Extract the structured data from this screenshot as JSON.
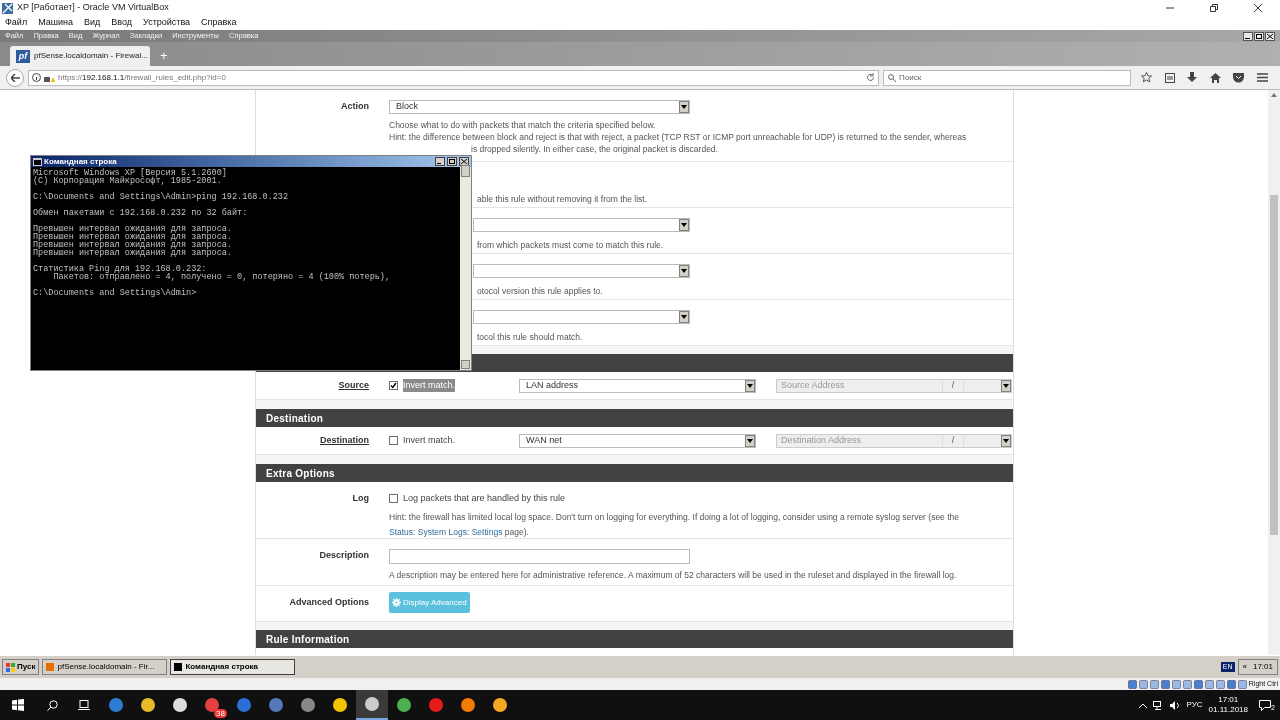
{
  "vbox": {
    "title": "XP [Работает] - Oracle VM VirtualBox",
    "menu": [
      "Файл",
      "Машина",
      "Вид",
      "Ввод",
      "Устройства",
      "Справка"
    ]
  },
  "firefox": {
    "menu": [
      "Файл",
      "Правка",
      "Вид",
      "Журнал",
      "Закладки",
      "Инструменты",
      "Справка"
    ],
    "tab": {
      "title": "pfSense.localdomain - Firewal...",
      "favicon": "pf"
    },
    "new_tab": "+",
    "url_prefix": "https://",
    "url_host": "192.168.1.1",
    "url_path": "/firewall_rules_edit.php?id=0",
    "search_placeholder": "Поиск"
  },
  "form": {
    "action": {
      "label": "Action",
      "value": "Block",
      "help": "Choose what to do with packets that match the criteria specified below.",
      "hint": "Hint: the difference between block and reject is that with reject, a packet (TCP RST or ICMP port unreachable for UDP) is returned to the sender, whereas",
      "hint_tail": "is dropped silently. In either case, the original packet is discarded."
    },
    "partial_rows": [
      {
        "kind": "text",
        "help": "able this rule without removing it from the list."
      },
      {
        "kind": "select",
        "help": "from which packets must come to match this rule."
      },
      {
        "kind": "select",
        "help": "otocol version this rule applies to."
      },
      {
        "kind": "select",
        "help": "tocol this rule should match."
      }
    ],
    "source": {
      "label": "Source",
      "invert_label": "Invert match.",
      "invert": true,
      "type": "LAN address",
      "address_placeholder": "Source Address",
      "slash": "/"
    },
    "destination_section": "Destination",
    "destination": {
      "label": "Destination",
      "invert_label": "Invert match.",
      "invert": false,
      "type": "WAN net",
      "address_placeholder": "Destination Address",
      "slash": "/"
    },
    "extra_section": "Extra Options",
    "log": {
      "label": "Log",
      "checkbox_label": "Log packets that are handled by this rule",
      "checked": false,
      "hint": "Hint: the firewall has limited local log space. Don't turn on logging for everything. If doing a lot of logging, consider using a remote syslog server (see the",
      "link": "Status: System Logs: Settings",
      "hint_end": "page)."
    },
    "description": {
      "label": "Description",
      "help": "A description may be entered here for administrative reference. A maximum of 52 characters will be used in the ruleset and displayed in the firewall log."
    },
    "advanced": {
      "label": "Advanced Options",
      "button": "Display Advanced"
    },
    "rule_info_section": "Rule Information"
  },
  "cmd": {
    "title": "Командная строка",
    "blocks": [
      [
        "Microsoft Windows XP [Версия 5.1.2600]",
        "(С) Корпорация Майкрософт, 1985-2001."
      ],
      [
        "C:\\Documents and Settings\\Admin>ping 192.168.0.232"
      ],
      [
        "Обмен пакетами с 192.168.0.232 по 32 байт:"
      ],
      [
        "Превышен интервал ожидания для запроса.",
        "Превышен интервал ожидания для запроса.",
        "Превышен интервал ожидания для запроса.",
        "Превышен интервал ожидания для запроса."
      ],
      [
        "Статистика Ping для 192.168.0.232:",
        "    Пакетов: отправлено = 4, получено = 0, потеряно = 4 (100% потерь),"
      ],
      [
        "C:\\Documents and Settings\\Admin>"
      ]
    ]
  },
  "xp_taskbar": {
    "start": "Пуск",
    "tasks": [
      {
        "label": "pfSense.localdomain - Fir...",
        "selected": false
      },
      {
        "label": "Командная строка",
        "selected": true
      }
    ],
    "lang": "EN",
    "collapse": "«",
    "time": "17:01"
  },
  "vbox_status": {
    "host_key": "Right Ctrl"
  },
  "win_taskbar": {
    "badge": "38",
    "lang": "РУС",
    "time": "17:01",
    "date": "01.11.2018",
    "notifications": "2"
  }
}
